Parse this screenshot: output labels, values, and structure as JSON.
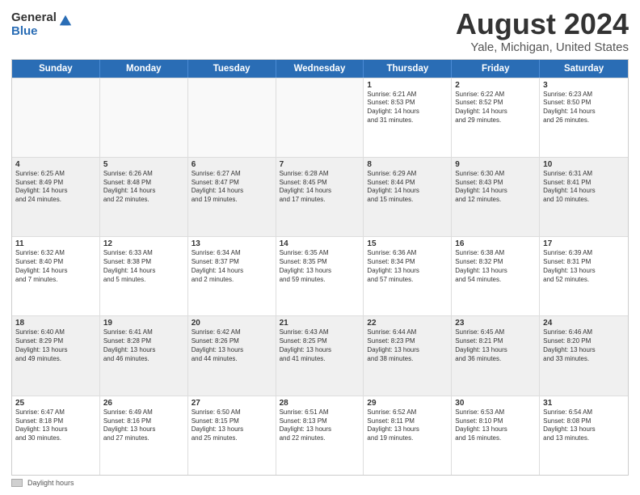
{
  "logo": {
    "general": "General",
    "blue": "Blue"
  },
  "title": "August 2024",
  "subtitle": "Yale, Michigan, United States",
  "days": [
    "Sunday",
    "Monday",
    "Tuesday",
    "Wednesday",
    "Thursday",
    "Friday",
    "Saturday"
  ],
  "footer_label": "Daylight hours",
  "weeks": [
    [
      {
        "day": "",
        "text": "",
        "empty": true
      },
      {
        "day": "",
        "text": "",
        "empty": true
      },
      {
        "day": "",
        "text": "",
        "empty": true
      },
      {
        "day": "",
        "text": "",
        "empty": true
      },
      {
        "day": "1",
        "text": "Sunrise: 6:21 AM\nSunset: 8:53 PM\nDaylight: 14 hours\nand 31 minutes.",
        "empty": false
      },
      {
        "day": "2",
        "text": "Sunrise: 6:22 AM\nSunset: 8:52 PM\nDaylight: 14 hours\nand 29 minutes.",
        "empty": false
      },
      {
        "day": "3",
        "text": "Sunrise: 6:23 AM\nSunset: 8:50 PM\nDaylight: 14 hours\nand 26 minutes.",
        "empty": false
      }
    ],
    [
      {
        "day": "4",
        "text": "Sunrise: 6:25 AM\nSunset: 8:49 PM\nDaylight: 14 hours\nand 24 minutes.",
        "empty": false
      },
      {
        "day": "5",
        "text": "Sunrise: 6:26 AM\nSunset: 8:48 PM\nDaylight: 14 hours\nand 22 minutes.",
        "empty": false
      },
      {
        "day": "6",
        "text": "Sunrise: 6:27 AM\nSunset: 8:47 PM\nDaylight: 14 hours\nand 19 minutes.",
        "empty": false
      },
      {
        "day": "7",
        "text": "Sunrise: 6:28 AM\nSunset: 8:45 PM\nDaylight: 14 hours\nand 17 minutes.",
        "empty": false
      },
      {
        "day": "8",
        "text": "Sunrise: 6:29 AM\nSunset: 8:44 PM\nDaylight: 14 hours\nand 15 minutes.",
        "empty": false
      },
      {
        "day": "9",
        "text": "Sunrise: 6:30 AM\nSunset: 8:43 PM\nDaylight: 14 hours\nand 12 minutes.",
        "empty": false
      },
      {
        "day": "10",
        "text": "Sunrise: 6:31 AM\nSunset: 8:41 PM\nDaylight: 14 hours\nand 10 minutes.",
        "empty": false
      }
    ],
    [
      {
        "day": "11",
        "text": "Sunrise: 6:32 AM\nSunset: 8:40 PM\nDaylight: 14 hours\nand 7 minutes.",
        "empty": false
      },
      {
        "day": "12",
        "text": "Sunrise: 6:33 AM\nSunset: 8:38 PM\nDaylight: 14 hours\nand 5 minutes.",
        "empty": false
      },
      {
        "day": "13",
        "text": "Sunrise: 6:34 AM\nSunset: 8:37 PM\nDaylight: 14 hours\nand 2 minutes.",
        "empty": false
      },
      {
        "day": "14",
        "text": "Sunrise: 6:35 AM\nSunset: 8:35 PM\nDaylight: 13 hours\nand 59 minutes.",
        "empty": false
      },
      {
        "day": "15",
        "text": "Sunrise: 6:36 AM\nSunset: 8:34 PM\nDaylight: 13 hours\nand 57 minutes.",
        "empty": false
      },
      {
        "day": "16",
        "text": "Sunrise: 6:38 AM\nSunset: 8:32 PM\nDaylight: 13 hours\nand 54 minutes.",
        "empty": false
      },
      {
        "day": "17",
        "text": "Sunrise: 6:39 AM\nSunset: 8:31 PM\nDaylight: 13 hours\nand 52 minutes.",
        "empty": false
      }
    ],
    [
      {
        "day": "18",
        "text": "Sunrise: 6:40 AM\nSunset: 8:29 PM\nDaylight: 13 hours\nand 49 minutes.",
        "empty": false
      },
      {
        "day": "19",
        "text": "Sunrise: 6:41 AM\nSunset: 8:28 PM\nDaylight: 13 hours\nand 46 minutes.",
        "empty": false
      },
      {
        "day": "20",
        "text": "Sunrise: 6:42 AM\nSunset: 8:26 PM\nDaylight: 13 hours\nand 44 minutes.",
        "empty": false
      },
      {
        "day": "21",
        "text": "Sunrise: 6:43 AM\nSunset: 8:25 PM\nDaylight: 13 hours\nand 41 minutes.",
        "empty": false
      },
      {
        "day": "22",
        "text": "Sunrise: 6:44 AM\nSunset: 8:23 PM\nDaylight: 13 hours\nand 38 minutes.",
        "empty": false
      },
      {
        "day": "23",
        "text": "Sunrise: 6:45 AM\nSunset: 8:21 PM\nDaylight: 13 hours\nand 36 minutes.",
        "empty": false
      },
      {
        "day": "24",
        "text": "Sunrise: 6:46 AM\nSunset: 8:20 PM\nDaylight: 13 hours\nand 33 minutes.",
        "empty": false
      }
    ],
    [
      {
        "day": "25",
        "text": "Sunrise: 6:47 AM\nSunset: 8:18 PM\nDaylight: 13 hours\nand 30 minutes.",
        "empty": false
      },
      {
        "day": "26",
        "text": "Sunrise: 6:49 AM\nSunset: 8:16 PM\nDaylight: 13 hours\nand 27 minutes.",
        "empty": false
      },
      {
        "day": "27",
        "text": "Sunrise: 6:50 AM\nSunset: 8:15 PM\nDaylight: 13 hours\nand 25 minutes.",
        "empty": false
      },
      {
        "day": "28",
        "text": "Sunrise: 6:51 AM\nSunset: 8:13 PM\nDaylight: 13 hours\nand 22 minutes.",
        "empty": false
      },
      {
        "day": "29",
        "text": "Sunrise: 6:52 AM\nSunset: 8:11 PM\nDaylight: 13 hours\nand 19 minutes.",
        "empty": false
      },
      {
        "day": "30",
        "text": "Sunrise: 6:53 AM\nSunset: 8:10 PM\nDaylight: 13 hours\nand 16 minutes.",
        "empty": false
      },
      {
        "day": "31",
        "text": "Sunrise: 6:54 AM\nSunset: 8:08 PM\nDaylight: 13 hours\nand 13 minutes.",
        "empty": false
      }
    ]
  ]
}
